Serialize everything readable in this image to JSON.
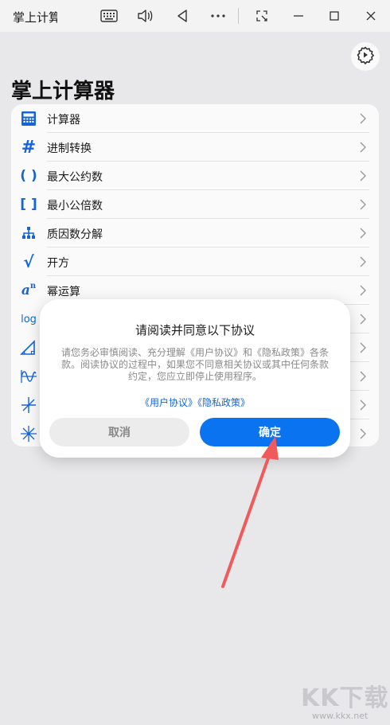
{
  "window": {
    "title": "掌上计算器",
    "icons": [
      "keyboard-icon",
      "volume-icon",
      "back-icon",
      "more-icon",
      "snip-icon",
      "minimize-icon",
      "maximize-icon",
      "close-icon"
    ]
  },
  "header": {
    "title": "掌上计算器",
    "settings_icon": "settings-gear-icon"
  },
  "list": {
    "items": [
      {
        "label": "计算器",
        "icon": "calculator-icon"
      },
      {
        "label": "进制转换",
        "icon": "hash-icon"
      },
      {
        "label": "最大公约数",
        "icon": "parentheses-icon"
      },
      {
        "label": "最小公倍数",
        "icon": "brackets-icon"
      },
      {
        "label": "质因数分解",
        "icon": "tree-icon"
      },
      {
        "label": "开方",
        "icon": "sqrt-icon"
      },
      {
        "label": "幂运算",
        "icon": "power-icon"
      },
      {
        "label": "",
        "icon": "log-icon"
      },
      {
        "label": "",
        "icon": "triangle-icon"
      },
      {
        "label": "",
        "icon": "wave-icon"
      },
      {
        "label": "",
        "icon": "asterisk-icon"
      },
      {
        "label": "",
        "icon": "star-icon"
      }
    ],
    "icon_glyphs": {
      "hash": "#",
      "paren": "( )",
      "bracket": "[ ]",
      "sqrt": "√",
      "power_base": "a",
      "power_exp": "n",
      "log": "log"
    }
  },
  "dialog": {
    "title": "请阅读并同意以下协议",
    "body": "请您务必审慎阅读、充分理解《用户协议》和《隐私政策》各条款。阅读协议的过程中，如果您不同意相关协议或其中任何条款约定，您应立即停止使用程序。",
    "links": "《用户协议》《隐私政策》",
    "cancel_label": "取消",
    "confirm_label": "确定"
  },
  "watermark": {
    "text": "KK下载",
    "url": "www.kkx.net"
  },
  "colors": {
    "accent": "#0a74f0",
    "icon_blue": "#1565d8",
    "annotation_red": "#f05a5a"
  }
}
